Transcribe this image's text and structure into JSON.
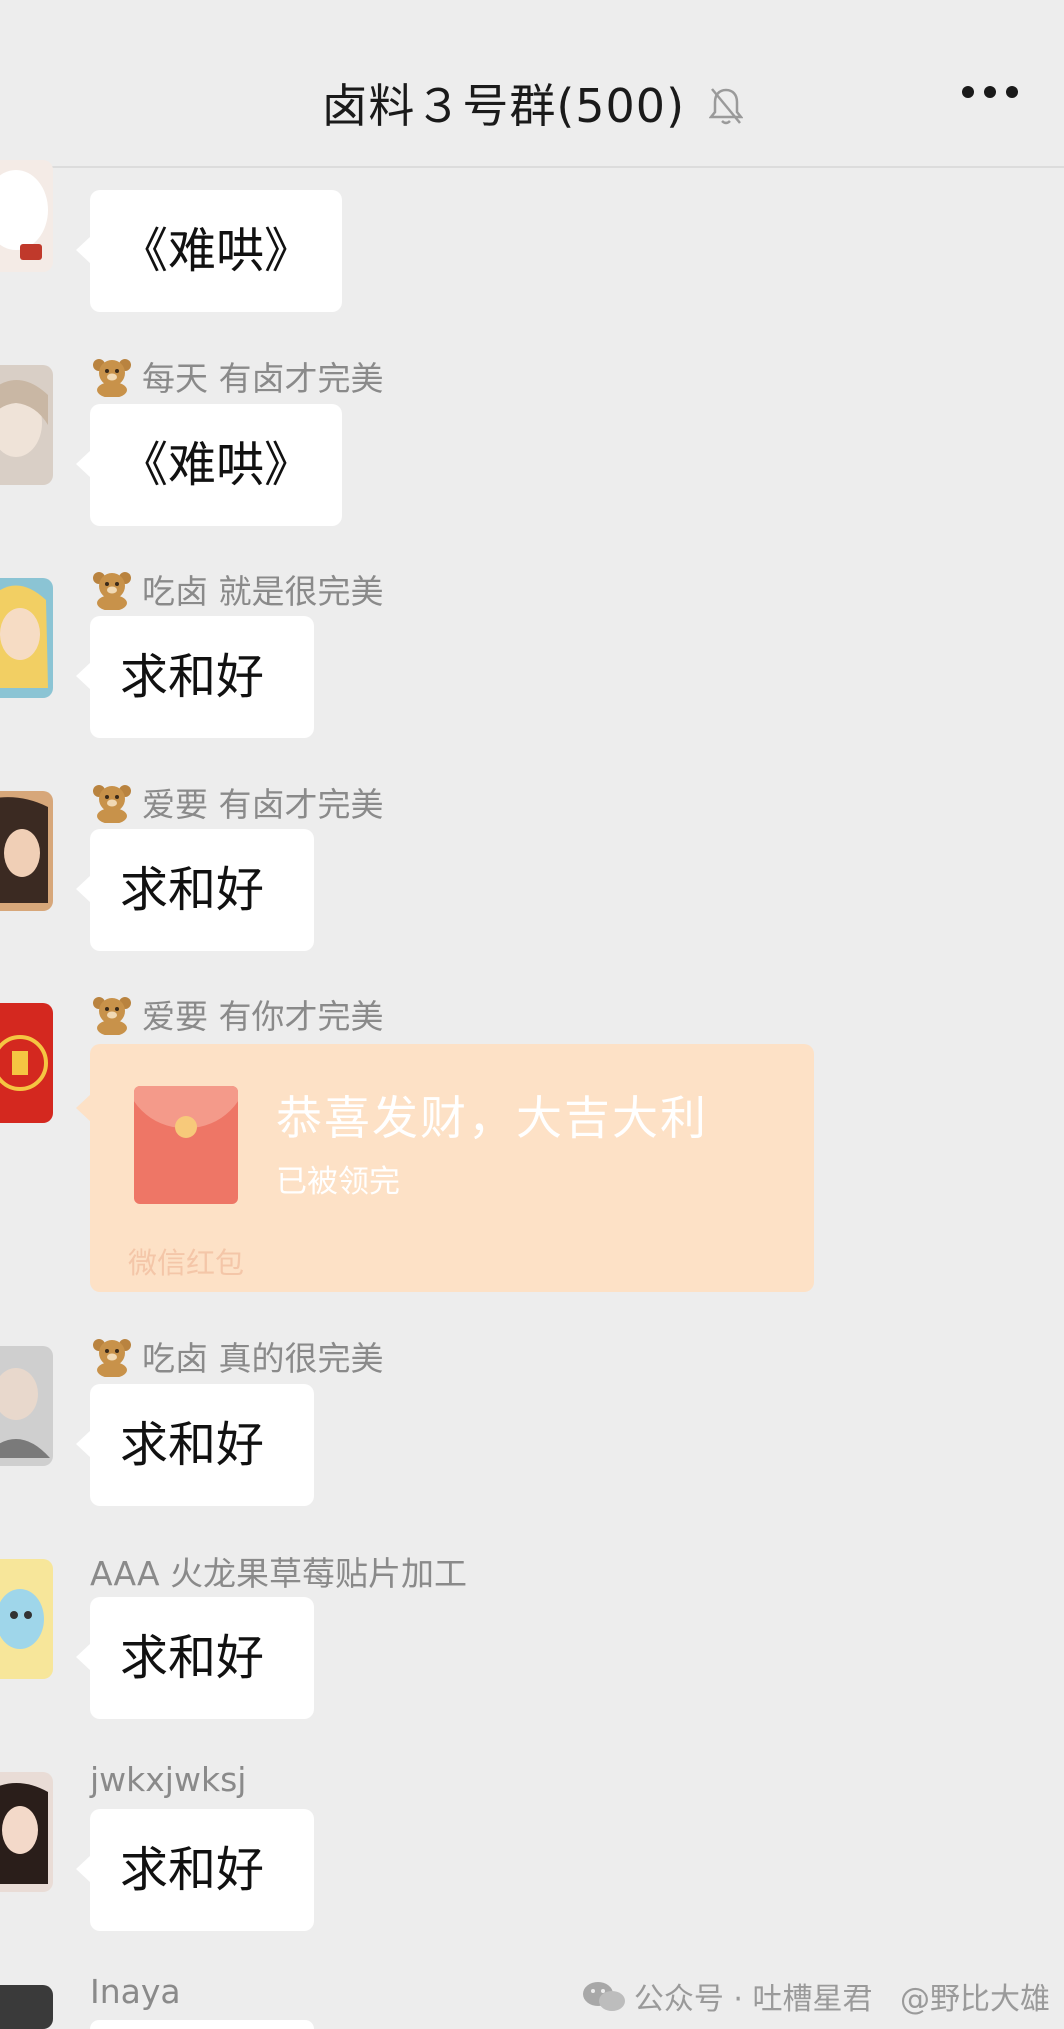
{
  "header": {
    "title": "卤料３号群(500)",
    "more_label": "more"
  },
  "messages": [
    {
      "sender": "",
      "text": "《难哄》"
    },
    {
      "sender": "每天 有卤才完美",
      "text": "《难哄》"
    },
    {
      "sender": "吃卤 就是很完美",
      "text": "求和好"
    },
    {
      "sender": "爱要 有卤才完美",
      "text": "求和好"
    },
    {
      "sender": "爱要 有你才完美",
      "red_packet": {
        "title": "恭喜发财，大吉大利",
        "status": "已被领完",
        "footer": "微信红包"
      }
    },
    {
      "sender": "吃卤 真的很完美",
      "text": "求和好"
    },
    {
      "sender": "AAA 火龙果草莓贴片加工",
      "text": "求和好"
    },
    {
      "sender": "jwkxjwksj",
      "text": "求和好"
    },
    {
      "sender": "Inaya"
    }
  ],
  "watermark": {
    "text": "公众号 · 吐槽星君",
    "handle": "@野比大雄"
  },
  "colors": {
    "background": "#ededed",
    "bubble": "#ffffff",
    "red_packet": "#fde1c6",
    "sender": "#8a8a8a"
  },
  "icons": [
    "mute-bell-icon",
    "more-dots-icon",
    "bear-emoji-icon",
    "red-envelope-icon",
    "wechat-logo-icon"
  ]
}
